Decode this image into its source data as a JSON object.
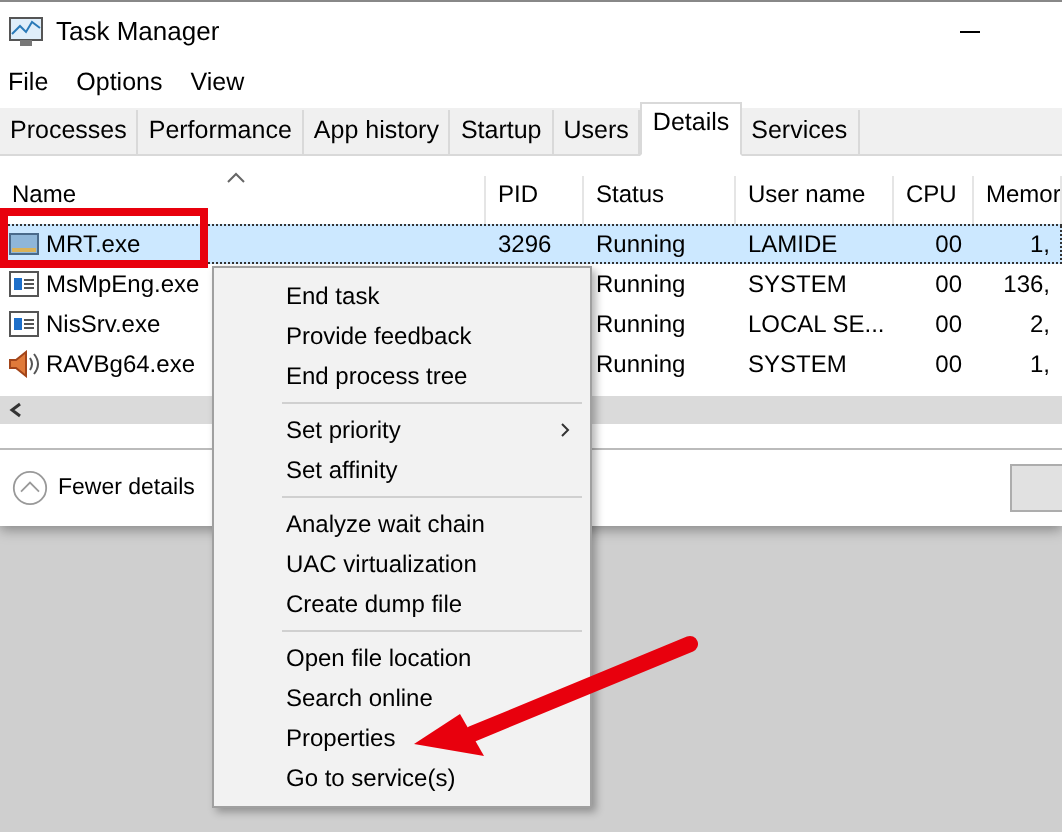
{
  "window": {
    "title": "Task Manager"
  },
  "menu": [
    "File",
    "Options",
    "View"
  ],
  "tabs": [
    {
      "label": "Processes",
      "selected": false
    },
    {
      "label": "Performance",
      "selected": false
    },
    {
      "label": "App history",
      "selected": false
    },
    {
      "label": "Startup",
      "selected": false
    },
    {
      "label": "Users",
      "selected": false
    },
    {
      "label": "Details",
      "selected": true
    },
    {
      "label": "Services",
      "selected": false
    }
  ],
  "table": {
    "columns": [
      "Name",
      "PID",
      "Status",
      "User name",
      "CPU",
      "Memor"
    ],
    "rows": [
      {
        "kind": "drive",
        "name": "MRT.exe",
        "pid": "3296",
        "status": "Running",
        "user": "LAMIDE",
        "cpu": "00",
        "memory": "1,",
        "selected": true
      },
      {
        "kind": "window",
        "name": "MsMpEng.exe",
        "status": "Running",
        "user": "SYSTEM",
        "cpu": "00",
        "memory": "136,",
        "selected": false
      },
      {
        "kind": "window",
        "name": "NisSrv.exe",
        "status": "Running",
        "user": "LOCAL SE...",
        "cpu": "00",
        "memory": "2,",
        "selected": false
      },
      {
        "kind": "speaker",
        "name": "RAVBg64.exe",
        "status": "Running",
        "user": "SYSTEM",
        "cpu": "00",
        "memory": "1,",
        "selected": false
      }
    ]
  },
  "footer": {
    "fewer_details": "Fewer details"
  },
  "context_menu": {
    "groups": [
      [
        {
          "label": "End task"
        },
        {
          "label": "Provide feedback"
        },
        {
          "label": "End process tree"
        }
      ],
      [
        {
          "label": "Set priority",
          "submenu": true
        },
        {
          "label": "Set affinity"
        }
      ],
      [
        {
          "label": "Analyze wait chain"
        },
        {
          "label": "UAC virtualization"
        },
        {
          "label": "Create dump file"
        }
      ],
      [
        {
          "label": "Open file location"
        },
        {
          "label": "Search online"
        },
        {
          "label": "Properties"
        },
        {
          "label": "Go to service(s)"
        }
      ]
    ]
  }
}
